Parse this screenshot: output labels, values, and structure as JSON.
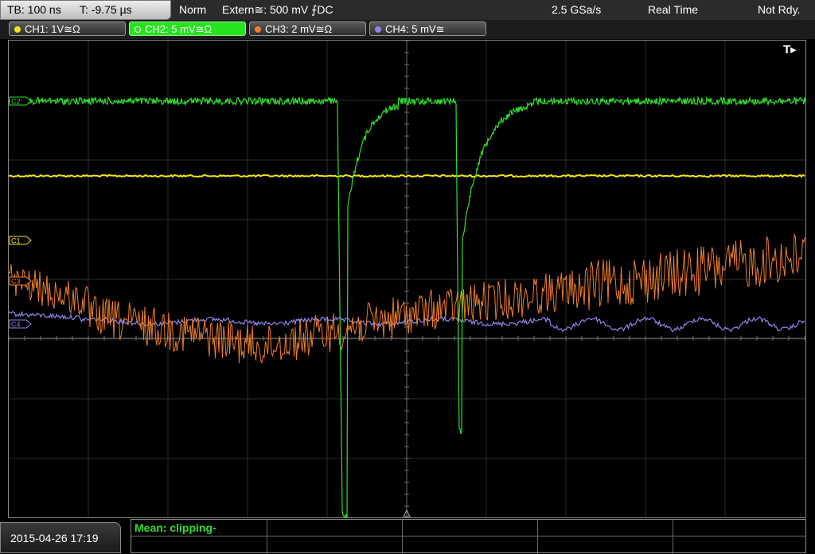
{
  "topbar": {
    "timebase": "TB: 100 ns",
    "trigger_time": "T: -9.75 µs",
    "mode": "Norm",
    "trigger": "Extern≅: 500 mV ⨍DC",
    "sample_rate": "2.5 GSa/s",
    "acquisition": "Real Time",
    "status": "Not Rdy."
  },
  "channels": [
    {
      "id": "ch1",
      "label": "CH1: 1V≅Ω",
      "color": "#f0e41c"
    },
    {
      "id": "ch2",
      "label": "CH2: 5 mV≅Ω",
      "color": "#2ee02b",
      "active": true
    },
    {
      "id": "ch3",
      "label": "CH3: 2 mV≅Ω",
      "color": "#f07d2a"
    },
    {
      "id": "ch4",
      "label": "CH4: 5 mV≅",
      "color": "#8c84e8"
    }
  ],
  "markers": {
    "ch2": "C2",
    "ch1": "C1",
    "ch3": "C3",
    "ch4": "C4",
    "trigger": "T▸"
  },
  "footer": {
    "datetime": "2015-04-26 17:19",
    "measurement": "Mean: clipping-"
  }
}
